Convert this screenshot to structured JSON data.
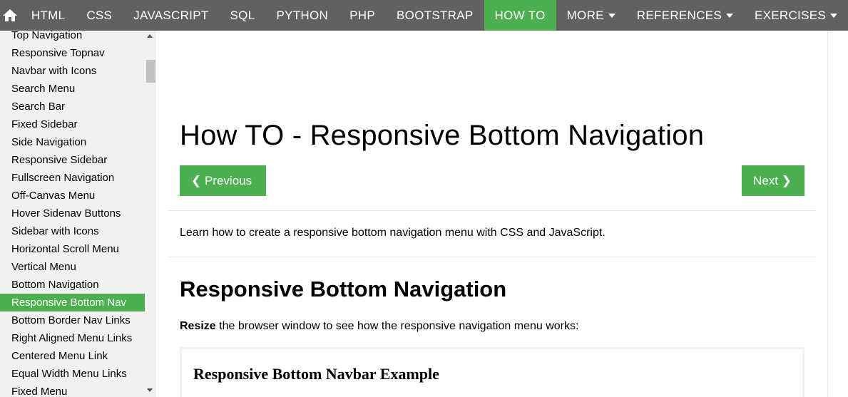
{
  "topnav": {
    "items": [
      "HTML",
      "CSS",
      "JAVASCRIPT",
      "SQL",
      "PYTHON",
      "PHP",
      "BOOTSTRAP",
      "HOW TO",
      "MORE"
    ],
    "right_items": [
      "REFERENCES",
      "EXERCISES"
    ],
    "active": "HOW TO",
    "home_icon": "home-icon",
    "bg_color": "#616161",
    "active_color": "#4CAF50"
  },
  "sidebar": {
    "links": [
      "Top Navigation",
      "Responsive Topnav",
      "Navbar with Icons",
      "Search Menu",
      "Search Bar",
      "Fixed Sidebar",
      "Side Navigation",
      "Responsive Sidebar",
      "Fullscreen Navigation",
      "Off-Canvas Menu",
      "Hover Sidenav Buttons",
      "Sidebar with Icons",
      "Horizontal Scroll Menu",
      "Vertical Menu",
      "Bottom Navigation",
      "Responsive Bottom Nav",
      "Bottom Border Nav Links",
      "Right Aligned Menu Links",
      "Centered Menu Link",
      "Equal Width Menu Links",
      "Fixed Menu"
    ],
    "active": "Responsive Bottom Nav"
  },
  "main": {
    "title": "How TO - Responsive Bottom Navigation",
    "prev_label": "❮ Previous",
    "next_label": "Next ❯",
    "intro": "Learn how to create a responsive bottom navigation menu with CSS and JavaScript.",
    "section_title": "Responsive Bottom Navigation",
    "resize_bold": "Resize",
    "resize_rest": " the browser window to see how the responsive navigation menu works:",
    "example_title": "Responsive Bottom Navbar Example"
  }
}
